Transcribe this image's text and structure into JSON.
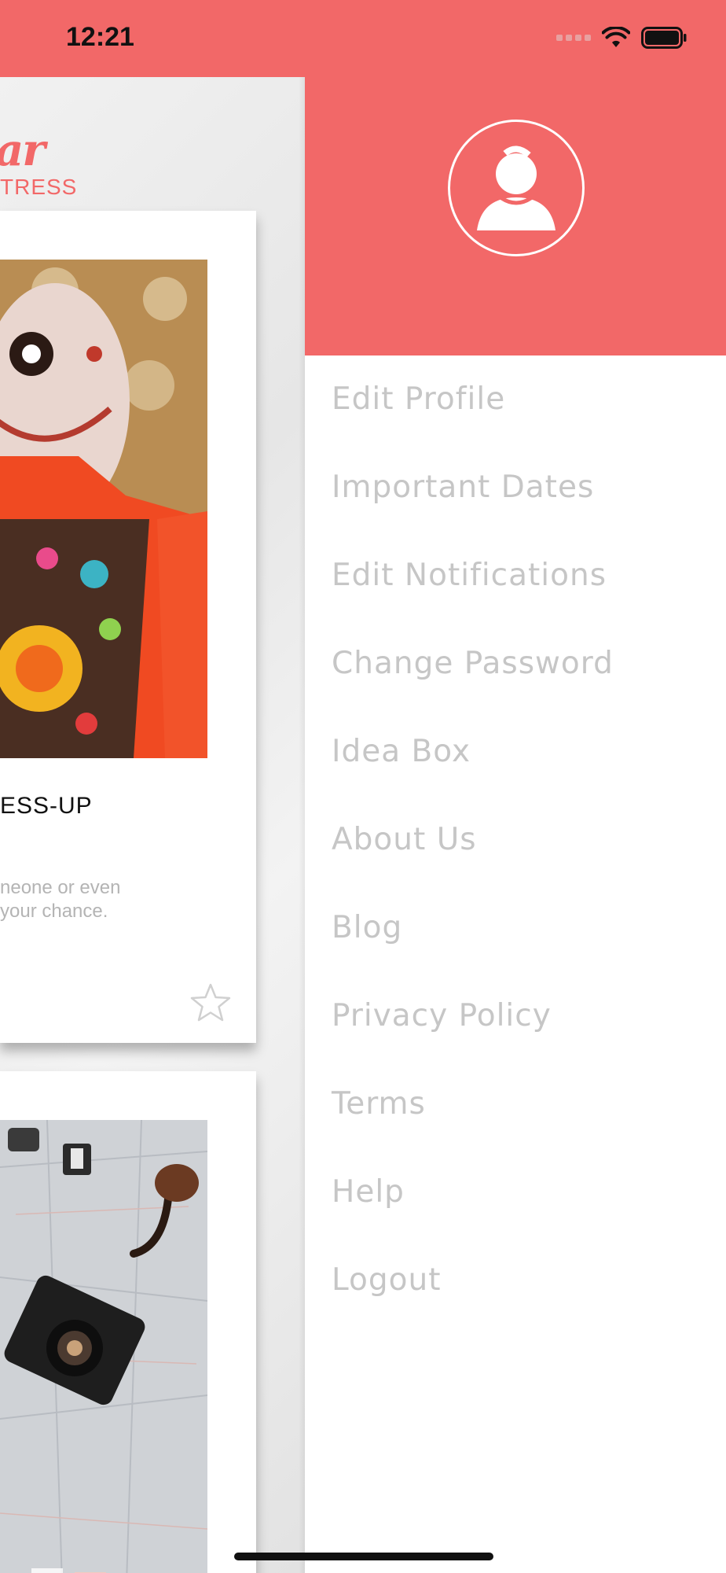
{
  "status_bar": {
    "time": "12:21",
    "icons": [
      "signal-dots-icon",
      "wifi-icon",
      "battery-icon"
    ]
  },
  "background_app": {
    "brand_script": "ar",
    "brand_sub": "TRESS",
    "cards": [
      {
        "title": "ESS-UP",
        "description": "neone or even\nyour chance.",
        "favorite_icon": "star-outline-icon"
      },
      {
        "photo": "flatlay-map-camera"
      }
    ],
    "bottom_bar_icon": "profile-icon"
  },
  "drawer": {
    "avatar_icon": "user-avatar-icon",
    "menu": [
      "Edit Profile",
      "Important Dates",
      "Edit Notifications",
      "Change Password",
      "Idea Box",
      "About Us",
      "Blog",
      "Privacy Policy",
      "Terms",
      "Help",
      "Logout"
    ]
  },
  "colors": {
    "accent": "#F26868",
    "bottom_bar": "#F38B8B",
    "menu_text": "#c6c6c6"
  }
}
